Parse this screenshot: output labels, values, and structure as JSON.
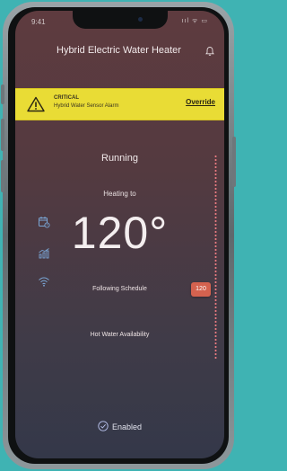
{
  "status_bar": {
    "time": "9:41",
    "icons": "ııl ᯤ ▭"
  },
  "header": {
    "title": "Hybrid Electric Water Heater",
    "bell_icon": "bell-icon"
  },
  "alert": {
    "severity": "CRITICAL",
    "message": "Hybrid Water Sensor Alarm",
    "action": "Override",
    "color": "#e9dc35"
  },
  "main": {
    "status": "Running",
    "mode": "Heating to",
    "temperature": "120°",
    "schedule": "Following Schedule",
    "hot_water": "Hot Water Availability",
    "setpoint_badge": "120"
  },
  "side_icons": [
    "calendar-icon",
    "usage-chart-icon",
    "wifi-icon"
  ],
  "footer": {
    "enabled": "Enabled"
  },
  "colors": {
    "accent": "#e87a80",
    "badge": "#d4624f"
  }
}
